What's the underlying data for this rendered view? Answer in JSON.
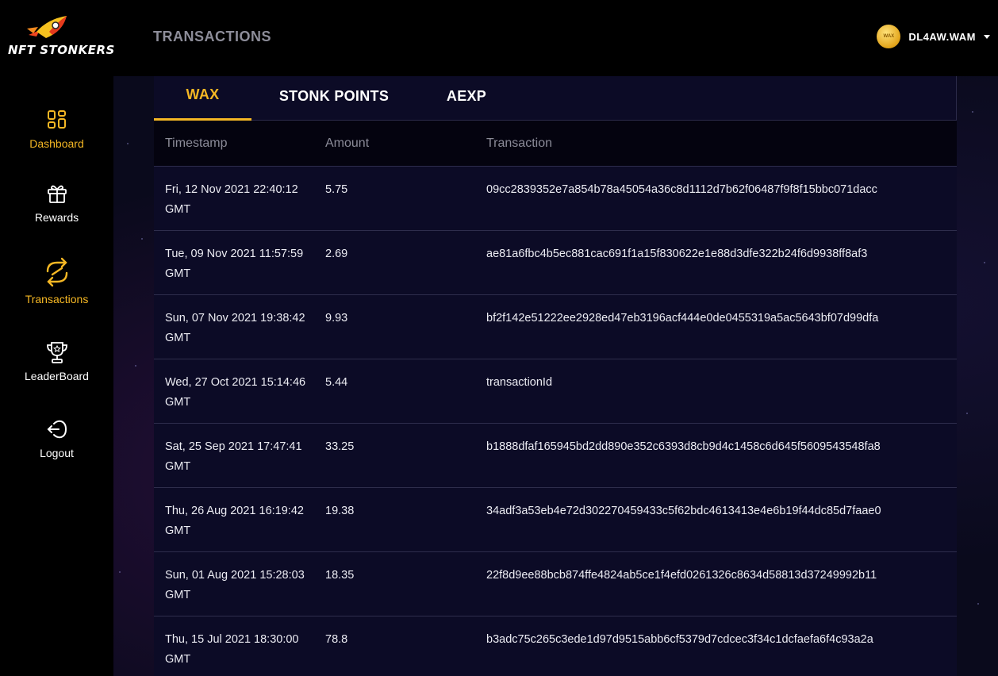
{
  "brand": {
    "name": "NFT STONKERS"
  },
  "header": {
    "title": "TRANSACTIONS",
    "coin_label": "WAX",
    "username": "DL4AW.WAM"
  },
  "sidebar": {
    "items": [
      {
        "label": "Dashboard",
        "icon": "dashboard-grid-icon",
        "active": true
      },
      {
        "label": "Rewards",
        "icon": "gift-icon",
        "active": false
      },
      {
        "label": "Transactions",
        "icon": "transactions-arrows-icon",
        "active": true
      },
      {
        "label": "LeaderBoard",
        "icon": "trophy-icon",
        "active": false
      },
      {
        "label": "Logout",
        "icon": "logout-icon",
        "active": false
      }
    ]
  },
  "tabs": [
    {
      "label": "WAX",
      "active": true
    },
    {
      "label": "STONK POINTS",
      "active": false
    },
    {
      "label": "AEXP",
      "active": false
    }
  ],
  "table": {
    "columns": [
      "Timestamp",
      "Amount",
      "Transaction"
    ],
    "rows": [
      {
        "timestamp": "Fri, 12 Nov 2021 22:40:12 GMT",
        "amount": "5.75",
        "transaction": "09cc2839352e7a854b78a45054a36c8d1112d7b62f06487f9f8f15bbc071dacc"
      },
      {
        "timestamp": "Tue, 09 Nov 2021 11:57:59 GMT",
        "amount": "2.69",
        "transaction": "ae81a6fbc4b5ec881cac691f1a15f830622e1e88d3dfe322b24f6d9938ff8af3"
      },
      {
        "timestamp": "Sun, 07 Nov 2021 19:38:42 GMT",
        "amount": "9.93",
        "transaction": "bf2f142e51222ee2928ed47eb3196acf444e0de0455319a5ac5643bf07d99dfa"
      },
      {
        "timestamp": "Wed, 27 Oct 2021 15:14:46 GMT",
        "amount": "5.44",
        "transaction": "transactionId"
      },
      {
        "timestamp": "Sat, 25 Sep 2021 17:47:41 GMT",
        "amount": "33.25",
        "transaction": "b1888dfaf165945bd2dd890e352c6393d8cb9d4c1458c6d645f5609543548fa8"
      },
      {
        "timestamp": "Thu, 26 Aug 2021 16:19:42 GMT",
        "amount": "19.38",
        "transaction": "34adf3a53eb4e72d302270459433c5f62bdc4613413e4e6b19f44dc85d7faae0"
      },
      {
        "timestamp": "Sun, 01 Aug 2021 15:28:03 GMT",
        "amount": "18.35",
        "transaction": "22f8d9ee88bcb874ffe4824ab5ce1f4efd0261326c8634d58813d37249992b11"
      },
      {
        "timestamp": "Thu, 15 Jul 2021 18:30:00 GMT",
        "amount": "78.8",
        "transaction": "b3adc75c265c3ede1d97d9515abb6cf5379d7cdcec3f34c1dcfaefa6f4c93a2a"
      }
    ]
  },
  "colors": {
    "accent": "#f5b724",
    "background": "#0c0b26",
    "sidebar": "#000000"
  }
}
